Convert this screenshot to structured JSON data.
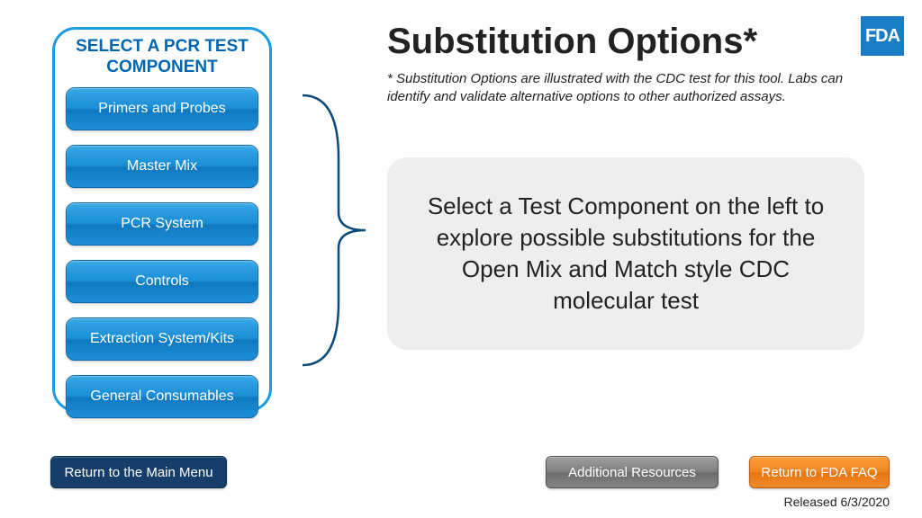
{
  "logo": "FDA",
  "title": "Substitution Options*",
  "subtitle": "* Substitution Options are illustrated with the CDC test for this tool. Labs can identify and validate alternative options to other authorized assays.",
  "panel": {
    "heading": "SELECT A PCR TEST COMPONENT",
    "items": [
      "Primers and Probes",
      "Master Mix",
      "PCR System",
      "Controls",
      "Extraction System/Kits",
      "General Consumables"
    ]
  },
  "instruction": "Select a Test Component on the left to explore possible substitutions for the Open Mix and Match style CDC molecular test",
  "buttons": {
    "main_menu": "Return to the Main Menu",
    "resources": "Additional Resources",
    "faq": "Return to FDA FAQ"
  },
  "release": "Released 6/3/2020"
}
